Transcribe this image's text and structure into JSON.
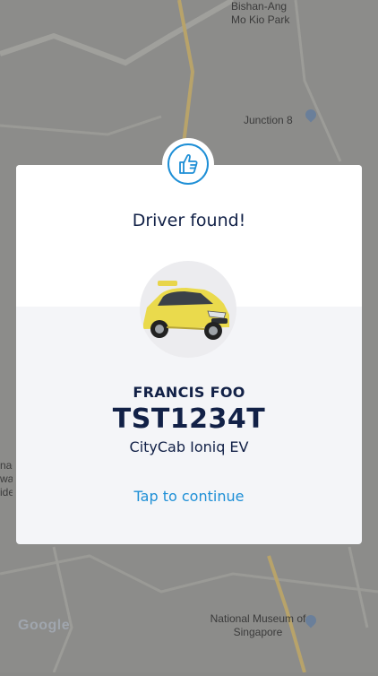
{
  "map": {
    "labels": {
      "park": "Bishan-Ang Mo Kio Park",
      "junction": "Junction 8",
      "museum": "National Museum of Singapore",
      "left_partial": "nad war ide"
    },
    "provider_logo": "Google"
  },
  "modal": {
    "badge_icon": "thumbs-up-icon",
    "title": "Driver found!",
    "vehicle_image": "yellow-taxi-car-image",
    "driver_name": "FRANCIS FOO",
    "plate_number": "TST1234T",
    "vehicle_description": "CityCab Ioniq EV",
    "continue_label": "Tap to continue"
  },
  "colors": {
    "accent": "#1e8fd6",
    "text_dark": "#122147",
    "card_bottom": "#f4f5f8"
  }
}
